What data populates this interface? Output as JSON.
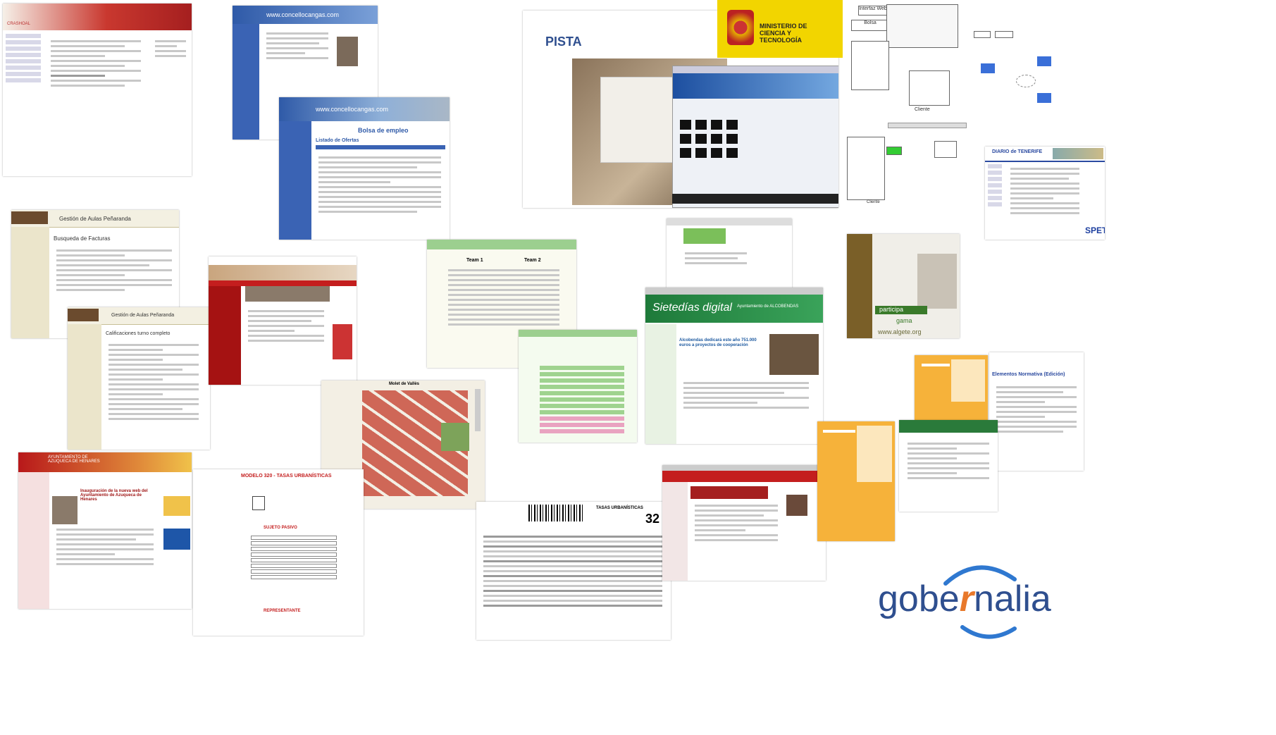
{
  "collage": {
    "shot_01": {
      "title": "",
      "brand": "CRASHOAL"
    },
    "shot_02": {
      "url": "www.concellocangas.com"
    },
    "shot_03": {
      "url": "www.concellocangas.com",
      "heading": "Bolsa de empleo",
      "subheading": "Listado de Ofertas"
    },
    "shot_04": {
      "brand": "PISTA",
      "ministry": "MINISTERIO DE CIENCIA Y TECNOLOGÍA"
    },
    "shot_05": {
      "label": "Cliente"
    },
    "shot_06": {
      "label": "Cliente"
    },
    "shot_07": {
      "brand": "DIARIO de TENERIFE",
      "badge": "SPET"
    },
    "shot_08": {
      "title": "Gestión de Aulas Peñaranda",
      "subtitle": "Busqueda de Facturas"
    },
    "shot_09": {
      "title": "Gestión de Aulas Peñaranda",
      "subtitle": "Calificaciones turno completo"
    },
    "shot_10": {
      "title": ""
    },
    "shot_11": {
      "tab1": "Team 1",
      "tab2": "Team 2"
    },
    "shot_12": {
      "title": ""
    },
    "shot_13": {
      "brand": "Sietedías digital",
      "sub": "Ayuntamiento de ALCOBENDAS",
      "headline": "Alcobendas dedicará este año 751.000 euros a proyectos de cooperación"
    },
    "shot_14": {
      "brand": "participa",
      "sub": "gama",
      "url": "www.algete.org"
    },
    "shot_15": {
      "title": "Molet de Vallès"
    },
    "shot_16": {
      "title": "AYUNTAMIENTO DE AZUQUECA DE HENARES",
      "headline": "Inauguración de la nueva web del Ayuntamiento de Azuqueca de Henares"
    },
    "shot_17": {
      "title": "MODELO 320 - TASAS URBANÍSTICAS",
      "section": "SUJETO PASIVO",
      "section2": "REPRESENTANTE"
    },
    "shot_18": {
      "title": "TASAS URBANÍSTICAS",
      "model": "32"
    },
    "shot_19": {
      "title": ""
    },
    "shot_20": {
      "title": "Elementos Normativa (Edición)"
    },
    "shot_21": {
      "title": ""
    }
  },
  "logo": {
    "brand": "gobernalia",
    "brand_part1": "gobe",
    "brand_accent": "r",
    "brand_part2": "nalia"
  },
  "colors": {
    "brand_blue": "#2f4f8f",
    "accent_orange": "#e8782a",
    "ministry_yellow": "#f2d500"
  }
}
